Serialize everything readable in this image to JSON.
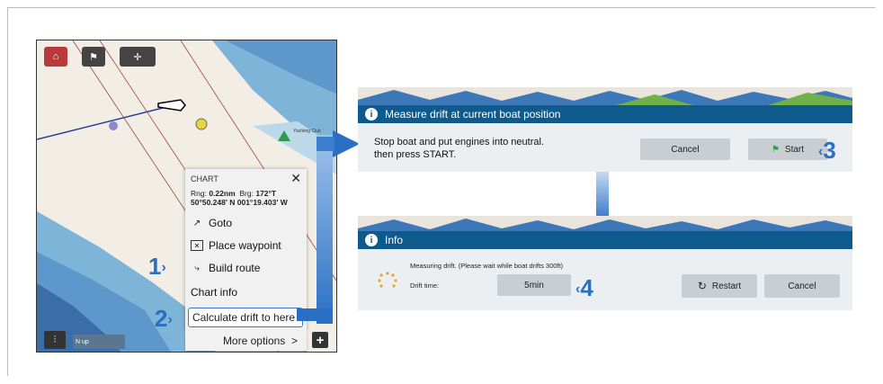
{
  "chart_screen": {
    "toolbar": [
      "home-icon",
      "waypoint-flag-icon",
      "crosshair-icon"
    ],
    "menu": {
      "header": "CHART",
      "close": "✕",
      "rng_label": "Rng:",
      "rng_value": "0.22nm",
      "brg_label": "Brg:",
      "brg_value": "172°T",
      "lat": "50°50.248' N",
      "lon": "001°19.403' W",
      "items": [
        "Goto",
        "Place waypoint",
        "Build route",
        "Chart info",
        "Calculate drift to here",
        "More options"
      ],
      "more_chevron": ">"
    },
    "bottom_left_label": "N up",
    "map_label": "Yachting Club"
  },
  "steps": [
    "1",
    "2",
    "3",
    "4"
  ],
  "dialog_measure": {
    "title": "Measure drift at current boat position",
    "message_line1": "Stop boat and put engines into neutral.",
    "message_line2": "then press START.",
    "cancel": "Cancel",
    "start": "Start"
  },
  "dialog_info": {
    "title": "Info",
    "status": "Measuring drift. (Please wait while boat drifts 300ft)",
    "drift_label": "Drift time:",
    "drift_value": "5min",
    "restart": "Restart",
    "cancel": "Cancel"
  },
  "colors": {
    "accent": "#2a6fc4",
    "dialog_bar": "#0f5a8c",
    "home_button": "#b83a3a"
  }
}
